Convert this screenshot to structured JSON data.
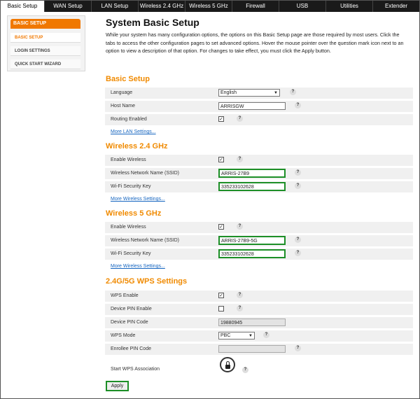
{
  "tabs": [
    "Basic Setup",
    "WAN Setup",
    "LAN Setup",
    "Wireless 2.4 GHz",
    "Wireless 5 GHz",
    "Firewall",
    "USB",
    "Utilities",
    "Extender"
  ],
  "sidebar": {
    "heading": "BASIC SETUP",
    "items": [
      "BASIC SETUP",
      "LOGIN SETTINGS",
      "QUICK START WIZARD"
    ]
  },
  "page": {
    "title": "System Basic Setup",
    "intro": "While your system has many configuration options, the options on this Basic Setup page are those required by most users. Click the tabs to access the other configuration pages to set advanced options. Hover the mouse pointer over the question mark icon next to an option to view a description of that option. For changes to take effect, you must click the Apply button."
  },
  "help_glyph": "?",
  "basic": {
    "heading": "Basic Setup",
    "language_label": "Language",
    "language_value": "English",
    "hostname_label": "Host Name",
    "hostname_value": "ARRISGW",
    "routing_label": "Routing Enabled",
    "more_link": "More LAN Settings..."
  },
  "w24": {
    "heading": "Wireless 2.4 GHz",
    "enable_label": "Enable Wireless",
    "ssid_label": "Wireless Network Name (SSID)",
    "ssid_value": "ARRIS-27B9",
    "key_label": "Wi-Fi Security Key",
    "key_value": "335233102628",
    "more_link": "More Wireless Settings..."
  },
  "w5": {
    "heading": "Wireless 5 GHz",
    "enable_label": "Enable Wireless",
    "ssid_label": "Wireless Network Name (SSID)",
    "ssid_value": "ARRIS-27B9-5G",
    "key_label": "Wi-Fi Security Key",
    "key_value": "335233102628",
    "more_link": "More Wireless Settings..."
  },
  "wps": {
    "heading": "2.4G/5G WPS Settings",
    "enable_label": "WPS Enable",
    "pin_enable_label": "Device PIN Enable",
    "pin_code_label": "Device PIN Code",
    "pin_code_value": "19880945",
    "mode_label": "WPS Mode",
    "mode_value": "PBC",
    "enrollee_label": "Enrollee PIN Code",
    "start_label": "Start WPS Association"
  },
  "apply_label": "Apply",
  "colors": {
    "accent": "#f08a00",
    "highlight": "#1d8f27",
    "link": "#1565c0",
    "tabbar": "#1a1a1a"
  }
}
